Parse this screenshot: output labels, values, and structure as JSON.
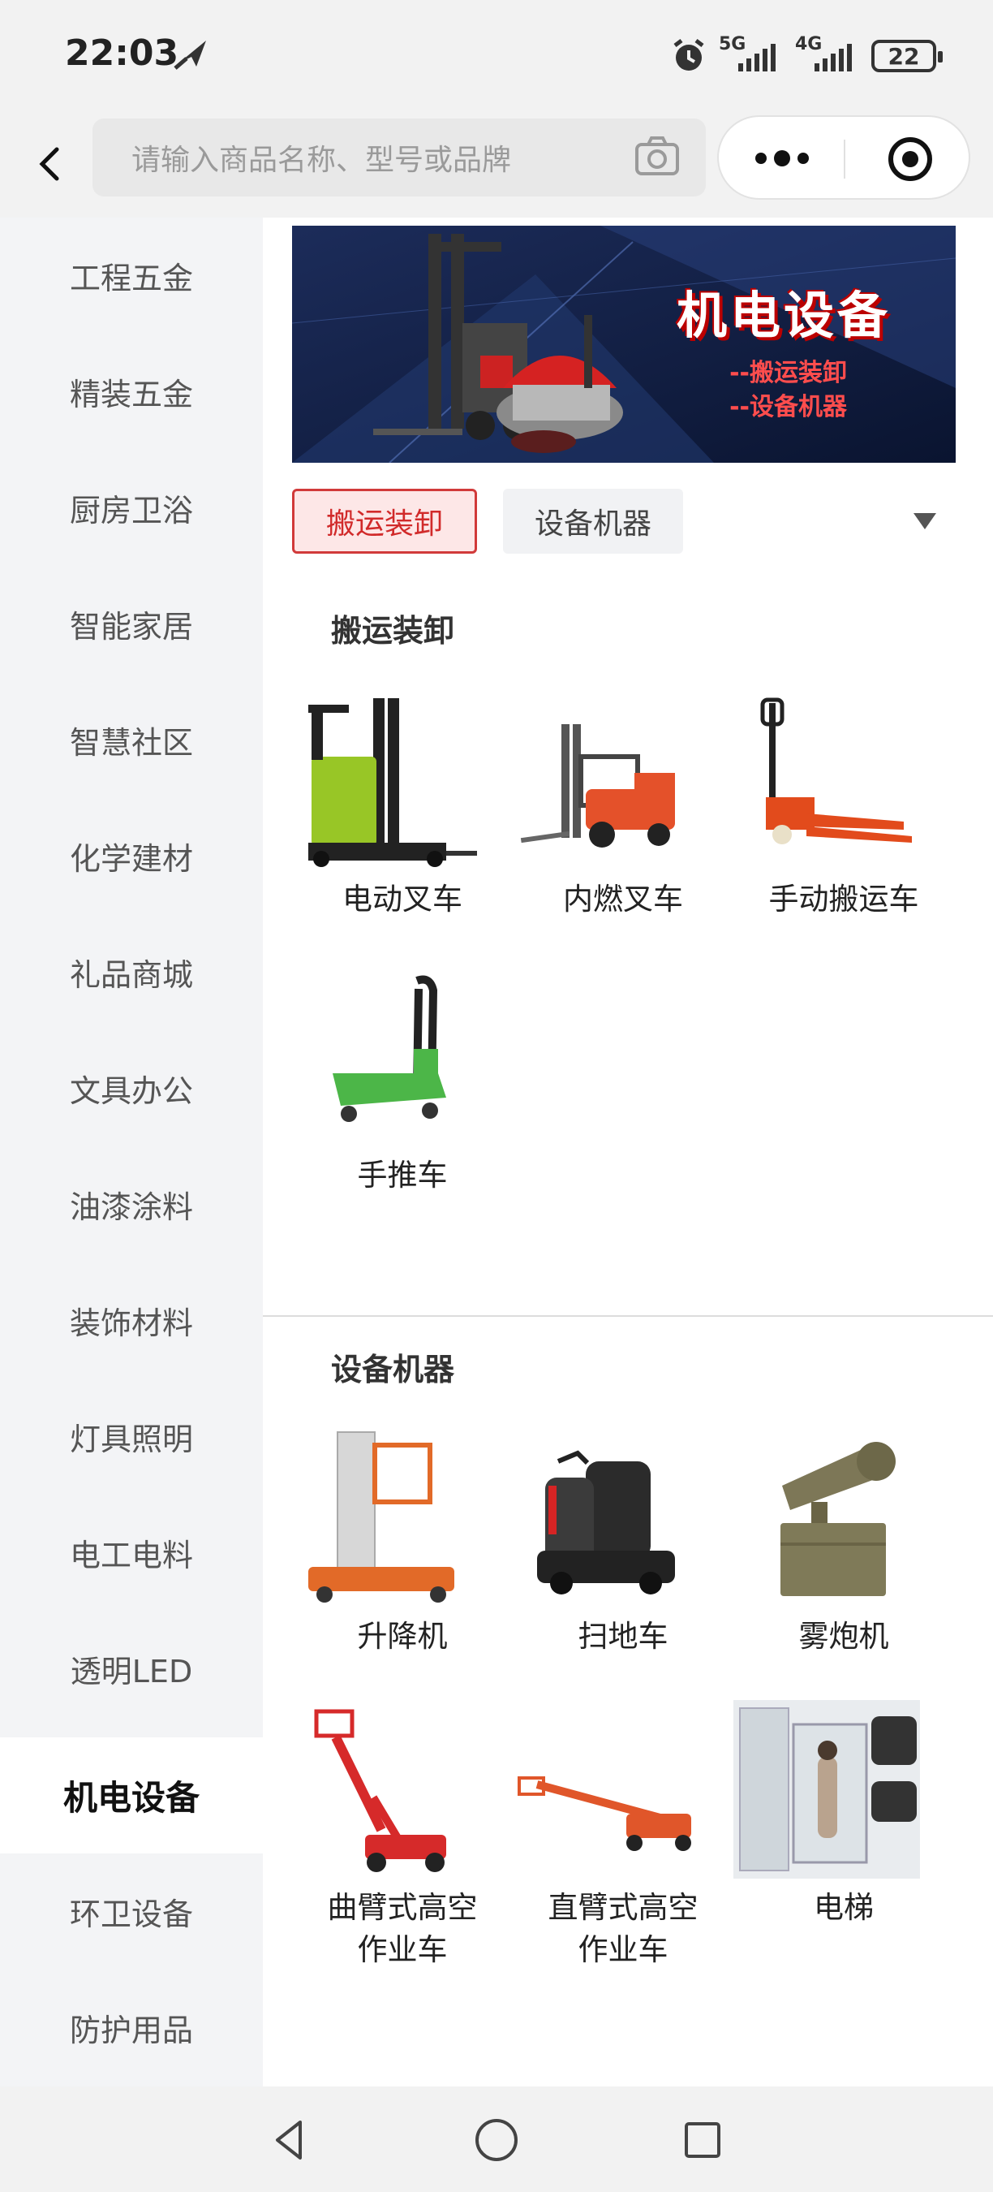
{
  "status": {
    "time": "22:03",
    "net1": "5G",
    "net2": "4G",
    "battery": "22"
  },
  "search": {
    "placeholder": "请输入商品名称、型号或品牌"
  },
  "sidebar": {
    "items": [
      {
        "label": "工程五金"
      },
      {
        "label": "精装五金"
      },
      {
        "label": "厨房卫浴"
      },
      {
        "label": "智能家居"
      },
      {
        "label": "智慧社区"
      },
      {
        "label": "化学建材"
      },
      {
        "label": "礼品商城"
      },
      {
        "label": "文具办公"
      },
      {
        "label": "油漆涂料"
      },
      {
        "label": "装饰材料"
      },
      {
        "label": "灯具照明"
      },
      {
        "label": "电工电料"
      },
      {
        "label": "透明LED"
      },
      {
        "label": "机电设备"
      },
      {
        "label": "环卫设备"
      },
      {
        "label": "防护用品"
      }
    ],
    "active": "机电设备"
  },
  "banner": {
    "title": "机电设备",
    "line1": "--搬运装卸",
    "line2": "--设备机器"
  },
  "tabs": [
    {
      "label": "搬运装卸"
    },
    {
      "label": "设备机器"
    }
  ],
  "sections": [
    {
      "title": "搬运装卸",
      "products": [
        {
          "name": "电动叉车"
        },
        {
          "name": "内燃叉车"
        },
        {
          "name": "手动搬运车"
        },
        {
          "name": "手推车"
        }
      ]
    },
    {
      "title": "设备机器",
      "products": [
        {
          "name": "升降机"
        },
        {
          "name": "扫地车"
        },
        {
          "name": "雾炮机"
        },
        {
          "name": "曲臂式高空\n作业车"
        },
        {
          "name": "直臂式高空\n作业车"
        },
        {
          "name": "电梯"
        }
      ]
    }
  ],
  "colors": {
    "accent": "#d12a2a",
    "sidebar_bg": "#f3f4f6"
  }
}
